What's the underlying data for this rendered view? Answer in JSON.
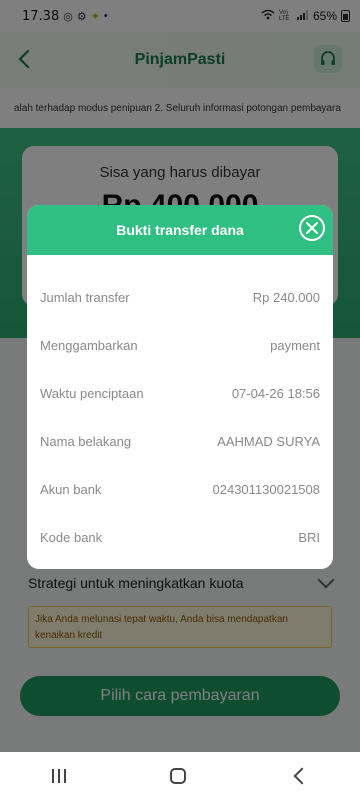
{
  "status_bar": {
    "time": "17.38",
    "battery": "65%",
    "network": "Vo) LTE"
  },
  "header": {
    "title": "PinjamPasti"
  },
  "marquee": {
    "text": "alah terhadap modus penipuan 2.  Seluruh informasi potongan pembayara"
  },
  "balance": {
    "label": "Sisa yang harus dibayar",
    "amount": "Rp 400.000"
  },
  "strategy": {
    "title": "Strategi untuk meningkatkan kuota",
    "note": "Jika Anda melunasi tepat waktu, Anda bisa mendapatkan kenaikan kredit"
  },
  "pay_button": {
    "label": "Pilih cara pembayaran"
  },
  "dialog": {
    "title": "Bukti transfer dana",
    "rows": [
      {
        "label": "Jumlah transfer",
        "value": "Rp 240.000"
      },
      {
        "label": "Menggambarkan",
        "value": "payment"
      },
      {
        "label": "Waktu penciptaan",
        "value": "07-04-26 18:56"
      },
      {
        "label": "Nama belakang",
        "value": "AAHMAD SURYA"
      },
      {
        "label": "Akun bank",
        "value": "024301130021508"
      },
      {
        "label": "Kode bank",
        "value": "BRI"
      }
    ]
  },
  "icons": {
    "back": "back-chevron-icon",
    "headset": "headset-icon",
    "close": "close-icon"
  },
  "colors": {
    "accent": "#2fbf82",
    "title": "#1a7a4a"
  }
}
